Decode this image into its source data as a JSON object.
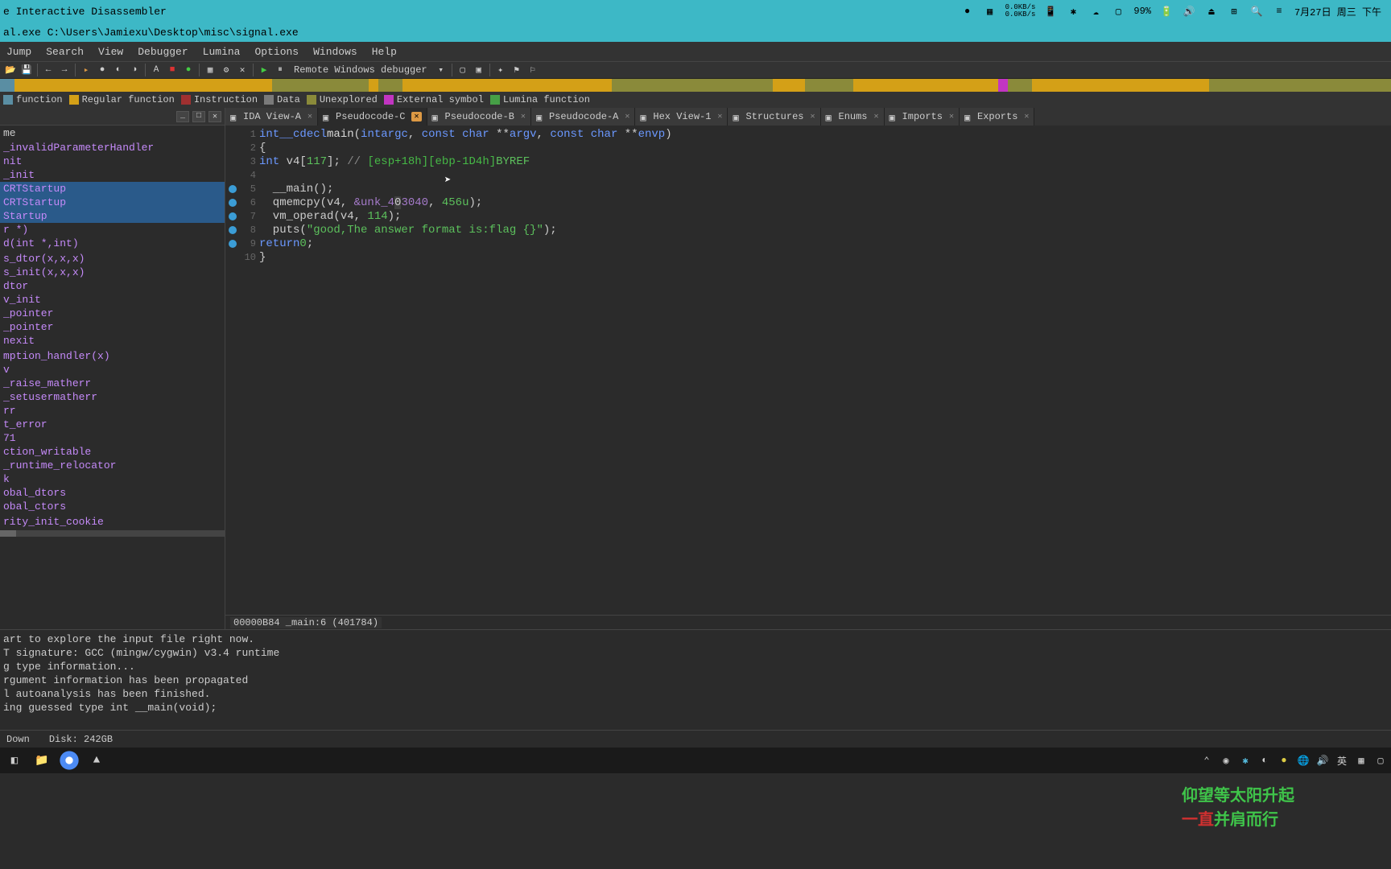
{
  "titlebar": {
    "title": "e Interactive Disassembler"
  },
  "sysTray": {
    "netUp": "0.0KB/s",
    "netDown": "0.0KB/s",
    "battery": "99%",
    "datetime": "7月27日 周三 下午"
  },
  "filepath": "al.exe C:\\Users\\Jamiexu\\Desktop\\misc\\signal.exe",
  "menu": [
    "Jump",
    "Search",
    "View",
    "Debugger",
    "Lumina",
    "Options",
    "Windows",
    "Help"
  ],
  "debugger": "Remote Windows debugger",
  "legend": [
    {
      "color": "#5a8ea3",
      "label": "function"
    },
    {
      "color": "#d4a017",
      "label": "Regular function"
    },
    {
      "color": "#a03030",
      "label": "Instruction"
    },
    {
      "color": "#7a7a7a",
      "label": "Data"
    },
    {
      "color": "#8a8a3a",
      "label": "Unexplored"
    },
    {
      "color": "#c235c2",
      "label": "External symbol"
    },
    {
      "color": "#46a046",
      "label": "Lumina function"
    }
  ],
  "functions": {
    "header": "me",
    "items": [
      {
        "name": "_invalidParameterHandler",
        "sel": false
      },
      {
        "name": "nit",
        "sel": false
      },
      {
        "name": "_init",
        "sel": false
      },
      {
        "name": "CRTStartup",
        "sel": true
      },
      {
        "name": "CRTStartup",
        "sel": true
      },
      {
        "name": "Startup",
        "sel": true
      },
      {
        "name": "r *)",
        "sel": false
      },
      {
        "name": "d(int *,int)",
        "sel": false
      },
      {
        "name": "",
        "sel": false
      },
      {
        "name": "s_dtor(x,x,x)",
        "sel": false
      },
      {
        "name": "s_init(x,x,x)",
        "sel": false
      },
      {
        "name": "dtor",
        "sel": false
      },
      {
        "name": "v_init",
        "sel": false
      },
      {
        "name": "_pointer",
        "sel": false
      },
      {
        "name": "_pointer",
        "sel": false
      },
      {
        "name": "nexit",
        "sel": false
      },
      {
        "name": "",
        "sel": false
      },
      {
        "name": "mption_handler(x)",
        "sel": false
      },
      {
        "name": "v",
        "sel": false
      },
      {
        "name": "_raise_matherr",
        "sel": false
      },
      {
        "name": "_setusermatherr",
        "sel": false
      },
      {
        "name": "rr",
        "sel": false
      },
      {
        "name": "t_error",
        "sel": false
      },
      {
        "name": "71",
        "sel": false
      },
      {
        "name": "ction_writable",
        "sel": false
      },
      {
        "name": "_runtime_relocator",
        "sel": false
      },
      {
        "name": "k",
        "sel": false
      },
      {
        "name": "obal_dtors",
        "sel": false
      },
      {
        "name": "obal_ctors",
        "sel": false
      },
      {
        "name": "",
        "sel": false
      },
      {
        "name": "rity_init_cookie",
        "sel": false
      }
    ]
  },
  "tabs": [
    {
      "label": "IDA View-A",
      "active": false
    },
    {
      "label": "Pseudocode-C",
      "active": true
    },
    {
      "label": "Pseudocode-B",
      "active": false
    },
    {
      "label": "Pseudocode-A",
      "active": false
    },
    {
      "label": "Hex View-1",
      "active": false
    },
    {
      "label": "Structures",
      "active": false
    },
    {
      "label": "Enums",
      "active": false
    },
    {
      "label": "Imports",
      "active": false
    },
    {
      "label": "Exports",
      "active": false
    }
  ],
  "code": {
    "lines": [
      {
        "n": 1,
        "bp": false,
        "html": "<span class='kw'>int</span> <span class='type'>__cdecl</span> <span class='fn'>main</span>(<span class='kw'>int</span> <span class='param'>argc</span>, <span class='kw'>const char</span> **<span class='param'>argv</span>, <span class='kw'>const char</span> **<span class='param'>envp</span>)"
      },
      {
        "n": 2,
        "bp": false,
        "html": "{"
      },
      {
        "n": 3,
        "bp": false,
        "html": "  <span class='kw'>int</span> v4[<span class='num'>117</span>]; <span class='comment'>// </span><span class='esp'>[esp+18h]</span> <span class='esp'>[ebp-1D4h]</span> <span class='byref'>BYREF</span>"
      },
      {
        "n": 4,
        "bp": false,
        "html": ""
      },
      {
        "n": 5,
        "bp": true,
        "html": "  __main();"
      },
      {
        "n": 6,
        "bp": true,
        "html": "  qmemcpy(v4, <span class='unk'>&unk_4</span><span class='highlight-caret'>0</span><span class='unk'>3040</span>, <span class='num'>456u</span>);"
      },
      {
        "n": 7,
        "bp": true,
        "html": "  vm_operad(v4, <span class='num'>114</span>);"
      },
      {
        "n": 8,
        "bp": true,
        "html": "  puts(<span class='str'>\"good,The answer format is:flag {}\"</span>);"
      },
      {
        "n": 9,
        "bp": true,
        "html": "  <span class='kw'>return</span> <span class='num'>0</span>;"
      },
      {
        "n": 10,
        "bp": false,
        "html": "}"
      }
    ]
  },
  "editorStatus": "00000B84 _main:6 (401784)",
  "output": [
    "art to explore the input file right now.",
    "T signature: GCC (mingw/cygwin) v3.4 runtime",
    "g type information...",
    "rgument information has been propagated",
    "l autoanalysis has been finished.",
    "ing guessed type int __main(void);"
  ],
  "overlay": {
    "line1": "仰望等太阳升起",
    "line2a": "一直",
    "line2b": "并肩而行"
  },
  "statusBar": {
    "left": "Down",
    "disk": "Disk: 242GB"
  },
  "taskbarTray": {
    "ime": "英"
  }
}
